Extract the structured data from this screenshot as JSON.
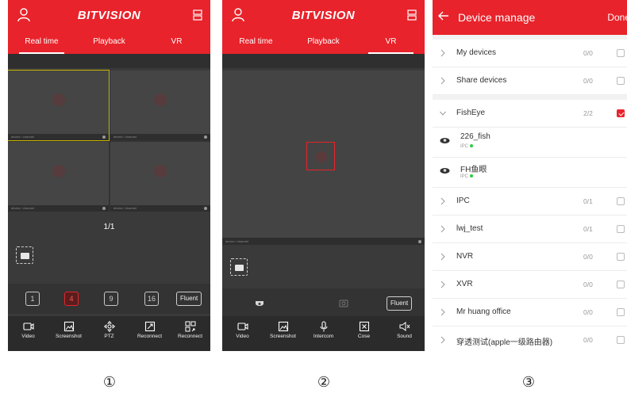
{
  "app": {
    "brand": "BITVISION",
    "tabs": [
      "Real time",
      "Playback",
      "VR"
    ]
  },
  "panel1": {
    "active_tab": 0,
    "tiles": [
      {
        "caption": "device / channel",
        "selected": true
      },
      {
        "caption": "device / channel",
        "selected": false
      },
      {
        "caption": "device / channel",
        "selected": false
      },
      {
        "caption": "device / channel",
        "selected": false
      }
    ],
    "page_indicator": "1/1",
    "split_options": [
      "1",
      "4",
      "9",
      "16"
    ],
    "split_active": 1,
    "quality": "Fluent",
    "toolbar": [
      "Video",
      "Screenshot",
      "PTZ",
      "Reconnect",
      "Reconnect"
    ]
  },
  "panel2": {
    "active_tab": 2,
    "tile_caption": "device / channel",
    "quality": "Fluent",
    "toolbar": [
      "Video",
      "Screenshot",
      "Intercom",
      "Cose",
      "Sound"
    ]
  },
  "panel3": {
    "title": "Device manage",
    "done": "Done",
    "groups": [
      {
        "name": "My devices",
        "count": "0/0",
        "checked": false
      },
      {
        "name": "Share devices",
        "count": "0/0",
        "checked": false
      }
    ],
    "fisheye": {
      "name": "FishEye",
      "count": "2/2",
      "checked": true,
      "devices": [
        {
          "name": "226_fish",
          "type": "IPC",
          "checked": true,
          "highlight": true
        },
        {
          "name": "FH鱼眼",
          "type": "IPC",
          "checked": false,
          "highlight": false
        }
      ]
    },
    "others": [
      {
        "name": "IPC",
        "count": "0/1",
        "checked": false
      },
      {
        "name": "lwj_test",
        "count": "0/1",
        "checked": false
      },
      {
        "name": "NVR",
        "count": "0/0",
        "checked": false
      },
      {
        "name": "XVR",
        "count": "0/0",
        "checked": false
      },
      {
        "name": "Mr huang office",
        "count": "0/0",
        "checked": false
      },
      {
        "name": "穿透测试(apple一级路由器)",
        "count": "0/0",
        "checked": false
      }
    ]
  },
  "figure_labels": [
    "①",
    "②",
    "③"
  ],
  "colors": {
    "accent": "#e8232b",
    "dark_bg": "#3a3a3a",
    "online": "#2ecc40"
  }
}
